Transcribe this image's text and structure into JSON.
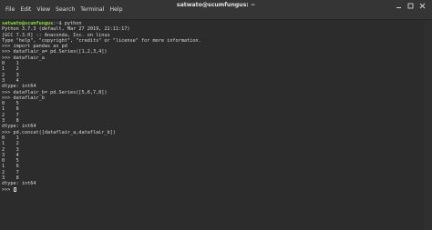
{
  "window": {
    "title": "satwato@scumfungus: ~"
  },
  "menu": [
    {
      "label": "File"
    },
    {
      "label": "Edit"
    },
    {
      "label": "View"
    },
    {
      "label": "Search"
    },
    {
      "label": "Terminal"
    },
    {
      "label": "Help"
    }
  ],
  "terminal": {
    "prompt_user": "satwato@scumfungus",
    "prompt_sep": ":",
    "prompt_path": "~",
    "prompt_cmd": "$ python",
    "lines": [
      "Python 3.7.3 (default, Mar 27 2019, 22:11:17)",
      "[GCC 7.3.0] :: Anaconda, Inc. on linux",
      "Type \"help\", \"copyright\", \"credits\" or \"license\" for more information.",
      ">>> import pandas as pd",
      ">>> dataflair_a= pd.Series([1,2,3,4])",
      ">>> dataflair_a",
      "0    1",
      "1    2",
      "2    3",
      "3    4",
      "dtype: int64",
      ">>> dataflair_b= pd.Series([5,6,7,8])",
      ">>> dataflair_b",
      "0    5",
      "1    6",
      "2    7",
      "3    8",
      "dtype: int64",
      ">>> pd.concat([dataflair_a,dataflair_b])",
      "0    1",
      "1    2",
      "2    3",
      "3    4",
      "0    5",
      "1    6",
      "2    7",
      "3    8",
      "dtype: int64"
    ],
    "last_prompt": ">>> "
  }
}
